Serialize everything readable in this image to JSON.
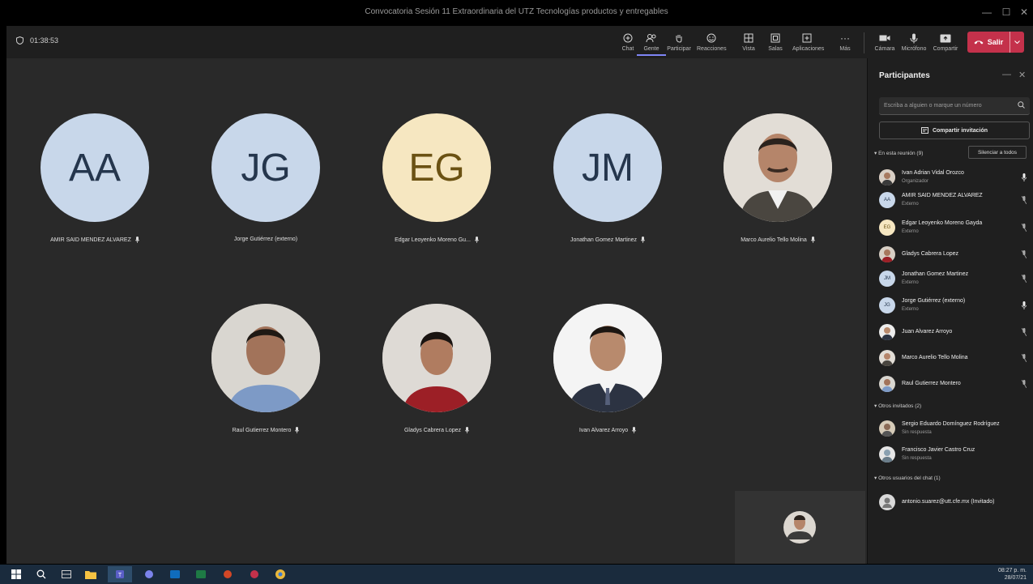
{
  "window": {
    "title": "Convocatoria Sesión 11 Extraordinaria del UTZ Tecnologías productos y entregables"
  },
  "meeting": {
    "timer": "01:38:53"
  },
  "toolbar": {
    "chat": "Chat",
    "people": "Gente",
    "raise": "Participar",
    "reactions": "Reacciones",
    "view": "Vista",
    "rooms": "Salas",
    "apps": "Aplicaciones",
    "more": "Más",
    "camera": "Cámara",
    "mic": "Micrófono",
    "share": "Compartir",
    "leave": "Salir"
  },
  "stage": {
    "tiles": [
      {
        "initials": "AA",
        "name": "AMIR SAID MENDEZ ALVAREZ",
        "bg": "#c8d7ea"
      },
      {
        "initials": "JG",
        "name": "Jorge Gutiérrez (externo)",
        "bg": "#c8d7ea"
      },
      {
        "initials": "EG",
        "name": "Edgar Leoyenko Moreno Gu...",
        "bg": "#f6e7c1"
      },
      {
        "initials": "JM",
        "name": "Jonathan Gomez Martinez",
        "bg": "#c8d7ea"
      },
      {
        "initials": "",
        "name": "Marco Aurelio Tello Molina",
        "bg": "#d9d4cc"
      },
      {
        "initials": "",
        "name": "Raul Gutierrez Montero",
        "bg": "#d9d4cc"
      },
      {
        "initials": "",
        "name": "Gladys Cabrera Lopez",
        "bg": "#d9d4cc"
      },
      {
        "initials": "",
        "name": "Ivan Alvarez Arroyo",
        "bg": "#f2f2f2"
      }
    ]
  },
  "panel": {
    "title": "Participantes",
    "search_placeholder": "Escriba a alguien o marque un número",
    "invite": "Compartir invitación",
    "in_meeting": "En esta reunión (9)",
    "mute_all": "Silenciar a todos",
    "participants": [
      {
        "name": "Ivan Adrian Vidal Orozco",
        "role": "Organizador",
        "initials": "",
        "photo": true
      },
      {
        "name": "AMIR SAID MENDEZ ALVAREZ",
        "role": "Externo",
        "initials": "AA",
        "photo": false
      },
      {
        "name": "Edgar Leoyenko Moreno Gayda",
        "role": "Externo",
        "initials": "EG",
        "photo": false
      },
      {
        "name": "Gladys Cabrera Lopez",
        "role": "",
        "initials": "",
        "photo": true
      },
      {
        "name": "Jonathan Gomez Martinez",
        "role": "Externo",
        "initials": "JM",
        "photo": false
      },
      {
        "name": "Jorge Gutiérrez (externo)",
        "role": "Externo",
        "initials": "JG",
        "photo": false
      },
      {
        "name": "Juan Alvarez Arroyo",
        "role": "",
        "initials": "",
        "photo": true
      },
      {
        "name": "Marco Aurelio Tello Molina",
        "role": "",
        "initials": "",
        "photo": true
      },
      {
        "name": "Raul Gutierrez Montero",
        "role": "",
        "initials": "",
        "photo": true
      }
    ],
    "others_invited": "Otros invitados (2)",
    "invited": [
      {
        "name": "Sergio Eduardo Domínguez Rodríguez",
        "role": "Sin respuesta"
      },
      {
        "name": "Francisco Javier Castro Cruz",
        "role": "Sin respuesta"
      }
    ],
    "chat_users": "Otros usuarios del chat (1)",
    "chat_list": [
      {
        "name": "antonio.suarez@utt.cfe.mx (Invitado)"
      }
    ]
  },
  "taskbar": {
    "time": "08:27 p. m.",
    "date": "28/07/21"
  }
}
